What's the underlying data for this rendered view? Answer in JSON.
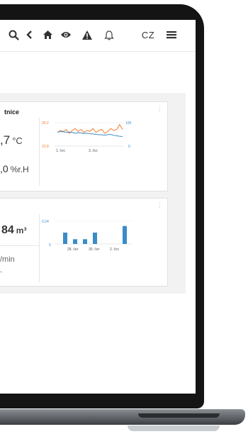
{
  "toolbar": {
    "items": [
      {
        "icon": "search-icon"
      },
      {
        "icon": "chevron-left-icon"
      },
      {
        "icon": "home-icon"
      },
      {
        "icon": "eye-icon"
      },
      {
        "icon": "warning-icon"
      },
      {
        "icon": "bell-icon"
      }
    ],
    "language": "CZ",
    "menu_icon": "hamburger-menu-icon"
  },
  "cards": [
    {
      "title": "tnice",
      "primary_value": ",7",
      "primary_unit": "°C",
      "secondary_value": ",0",
      "secondary_unit": "%r.H"
    },
    {
      "title": "",
      "primary_value": "84",
      "primary_unit": "m³",
      "secondary_value": "/min",
      "tertiary_value": "-"
    }
  ],
  "chart_data": [
    {
      "type": "line",
      "x_ticks": [
        "1. čvc",
        "3. čvc"
      ],
      "y_left_ticks": [
        "25.2",
        "22.8"
      ],
      "y_right_ticks": [
        "100",
        "0"
      ],
      "series": [
        {
          "color": "#f07b2d",
          "axis": "left",
          "values": [
            24.2,
            24.4,
            24.3,
            24.5,
            24.1,
            24.4,
            24.6,
            24.3,
            24.5,
            24.2,
            24.4,
            24.3,
            24.6,
            24.2,
            24.4,
            24.5,
            24.1,
            24.3,
            24.6,
            24.4,
            24.5,
            25.0,
            24.5
          ]
        },
        {
          "color": "#3a8cc7",
          "axis": "right",
          "values": [
            60,
            62,
            61,
            59,
            60,
            58,
            55,
            57,
            56,
            54,
            55,
            53,
            52,
            50,
            49,
            48,
            47,
            49,
            50,
            46,
            44,
            42,
            41
          ]
        }
      ],
      "colors": {
        "left_axis": "#f07b2d",
        "right_axis": "#3a8cc7"
      }
    },
    {
      "type": "bar",
      "x_ticks": [
        "28. čer",
        "30. čer",
        "2. čvc"
      ],
      "y_ticks": [
        "0.24",
        "0"
      ],
      "ylim": [
        0,
        0.24
      ],
      "values": [
        0.12,
        0.05,
        0.05,
        0.12,
        0,
        0,
        0.19
      ],
      "color": "#3a8cc7"
    }
  ]
}
